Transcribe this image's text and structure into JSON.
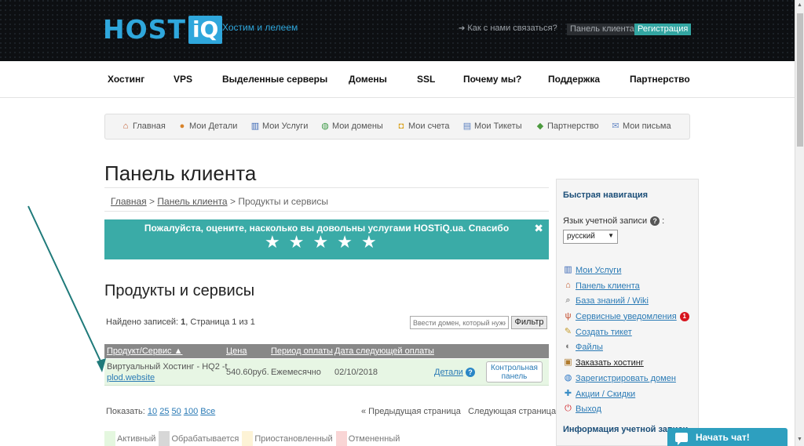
{
  "header": {
    "logo_host": "HOST",
    "logo_iq": "iQ",
    "tagline": "Хостим и лелеем",
    "contact": "Как с нами связаться?",
    "client_panel": "Панель клиента",
    "register": "Регистрация"
  },
  "mainnav": [
    "Хостинг",
    "VPS",
    "Выделенные серверы",
    "Домены",
    "SSL",
    "Почему мы?",
    "Поддержка",
    "Партнерство"
  ],
  "clientnav": [
    {
      "label": "Главная",
      "icon": "home-icon"
    },
    {
      "label": "Мои Детали",
      "icon": "user-icon"
    },
    {
      "label": "Мои Услуги",
      "icon": "services-icon"
    },
    {
      "label": "Мои домены",
      "icon": "globe-icon"
    },
    {
      "label": "Мои счета",
      "icon": "invoice-icon"
    },
    {
      "label": "Мои Тикеты",
      "icon": "ticket-icon"
    },
    {
      "label": "Партнерство",
      "icon": "affiliate-icon"
    },
    {
      "label": "Мои письма",
      "icon": "mail-icon"
    }
  ],
  "page_title": "Панель клиента",
  "breadcrumb": {
    "home": "Главная",
    "panel": "Панель клиента",
    "sep": ">",
    "current": "Продукты и сервисы"
  },
  "rating": {
    "text": "Пожалуйста, оцените, насколько вы довольны услугами HOSTiQ.ua. Спасибо",
    "close": "✖",
    "stars": 5
  },
  "section_title": "Продукты и сервисы",
  "found": {
    "prefix": "Найдено записей:",
    "count": "1",
    "page_text": ", Страница 1 из 1"
  },
  "search": {
    "placeholder": "Ввести домен, который нужно найти"
  },
  "filter_button": "Фильтр",
  "table": {
    "headers": [
      "Продукт/Сервис ▲",
      "Цена",
      "Период оплаты",
      "Дата следующей оплаты"
    ],
    "rows": [
      {
        "product": "Виртуальный Хостинг - HQ2 -t",
        "domain": "plod.website",
        "price": "540.60руб.",
        "period": "Ежемесячно",
        "next_date": "02/10/2018",
        "details": "Детали",
        "control": "Контрольная панель"
      }
    ]
  },
  "show": {
    "label": "Показать:",
    "options": [
      "10",
      "25",
      "50",
      "100",
      "Все"
    ]
  },
  "pager": {
    "prev": "« Предыдущая страница",
    "next": "Следующая страница »"
  },
  "legend": [
    {
      "label": "Активный",
      "color": "#e4f7df"
    },
    {
      "label": "Обрабатывается",
      "color": "#d7d7d7"
    },
    {
      "label": "Приостановленный",
      "color": "#fdf3d6"
    },
    {
      "label": "Отмененный",
      "color": "#f9d5d5"
    }
  ],
  "sidebar": {
    "title": "Быстрая навигация",
    "lang_label": "Язык учетной записи",
    "lang_colon": ":",
    "lang_value": "русский",
    "links": [
      {
        "label": "Мои Услуги",
        "icon": "services-icon"
      },
      {
        "label": "Панель клиента",
        "icon": "home-icon"
      },
      {
        "label": "База знаний / Wiki",
        "icon": "search-icon"
      },
      {
        "label": "Сервисные уведомления",
        "icon": "antenna-icon",
        "badge": "1"
      },
      {
        "label": "Создать тикет",
        "icon": "ticket-icon"
      },
      {
        "label": "Файлы",
        "icon": "files-icon"
      },
      {
        "label": "Заказать хостинг",
        "icon": "box-icon"
      },
      {
        "label": "Зарегистрировать домен",
        "icon": "globe-icon"
      },
      {
        "label": "Акции / Скидки",
        "icon": "gift-icon"
      },
      {
        "label": "Выход",
        "icon": "logout-icon"
      }
    ],
    "account_title": "Информация учетной записи"
  },
  "chat": "Начать чат!",
  "colors": {
    "accent": "#3aaba7",
    "brand": "#2fa7dc",
    "link": "#2a7ab5",
    "badge": "#d7141e"
  }
}
